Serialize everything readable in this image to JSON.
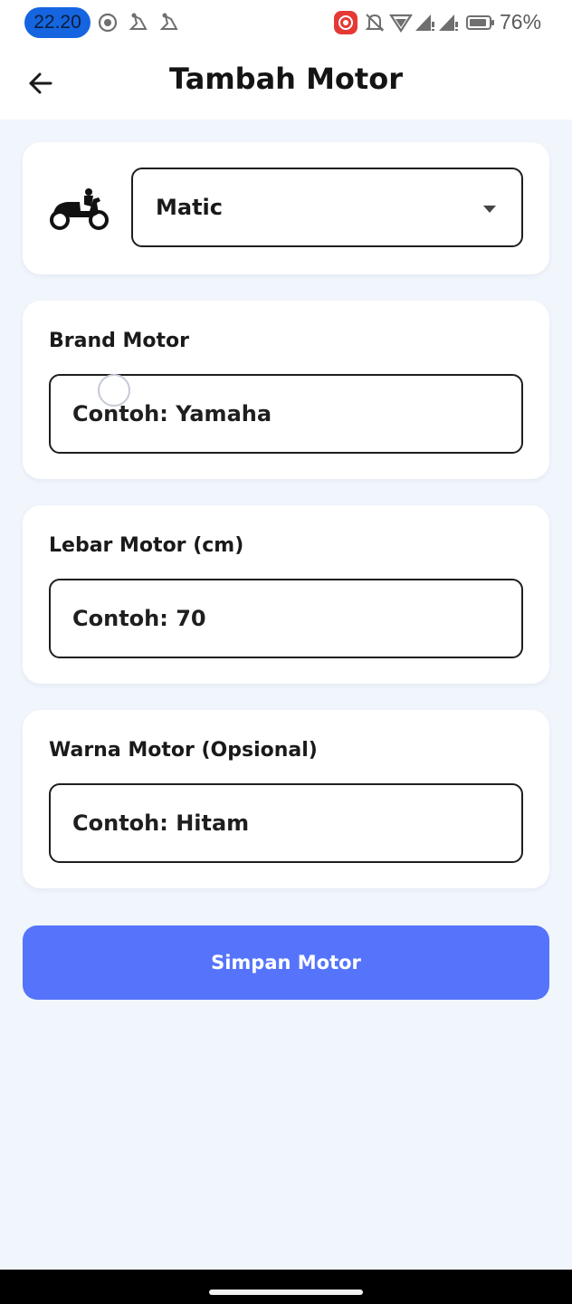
{
  "status_bar": {
    "time": "22.20",
    "battery": "76%",
    "icons": [
      "screen-record-icon",
      "walk-icon",
      "walk-icon",
      "recorder-icon",
      "bell-off-icon",
      "wifi-icon",
      "signal-icon",
      "signal-icon",
      "battery-icon"
    ]
  },
  "app_bar": {
    "title": "Tambah Motor",
    "back_icon": "arrow-left-icon"
  },
  "type_select": {
    "icon": "scooter-icon",
    "value": "Matic"
  },
  "fields": {
    "brand": {
      "label": "Brand Motor",
      "placeholder": "Contoh: Yamaha"
    },
    "width": {
      "label": "Lebar Motor (cm)",
      "placeholder": "Contoh: 70"
    },
    "color": {
      "label": "Warna Motor (Opsional)",
      "placeholder": "Contoh: Hitam"
    }
  },
  "save_button": {
    "label": "Simpan Motor"
  },
  "colors": {
    "accent": "#5574fb",
    "background": "#f1f5fc",
    "time_pill": "#1565e0",
    "recorder": "#e53935"
  }
}
